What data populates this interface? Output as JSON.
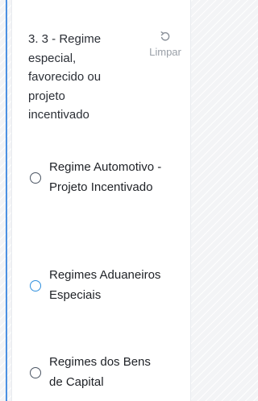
{
  "question": {
    "title": "3. 3 - Regime especial, favorecido ou projeto incentivado",
    "clear_label": "Limpar"
  },
  "options": [
    {
      "label": "Regime Automotivo - Projeto Incentivado"
    },
    {
      "label": "Regimes Aduaneiros Especiais"
    },
    {
      "label": "Regimes dos Bens de Capital"
    }
  ],
  "colors": {
    "accent": "#4a90e2",
    "hover_radio": "#2f8fdd",
    "text": "#1e2126",
    "muted": "#9aa0a8"
  },
  "icons": {
    "clear": "undo-arrow-icon"
  }
}
